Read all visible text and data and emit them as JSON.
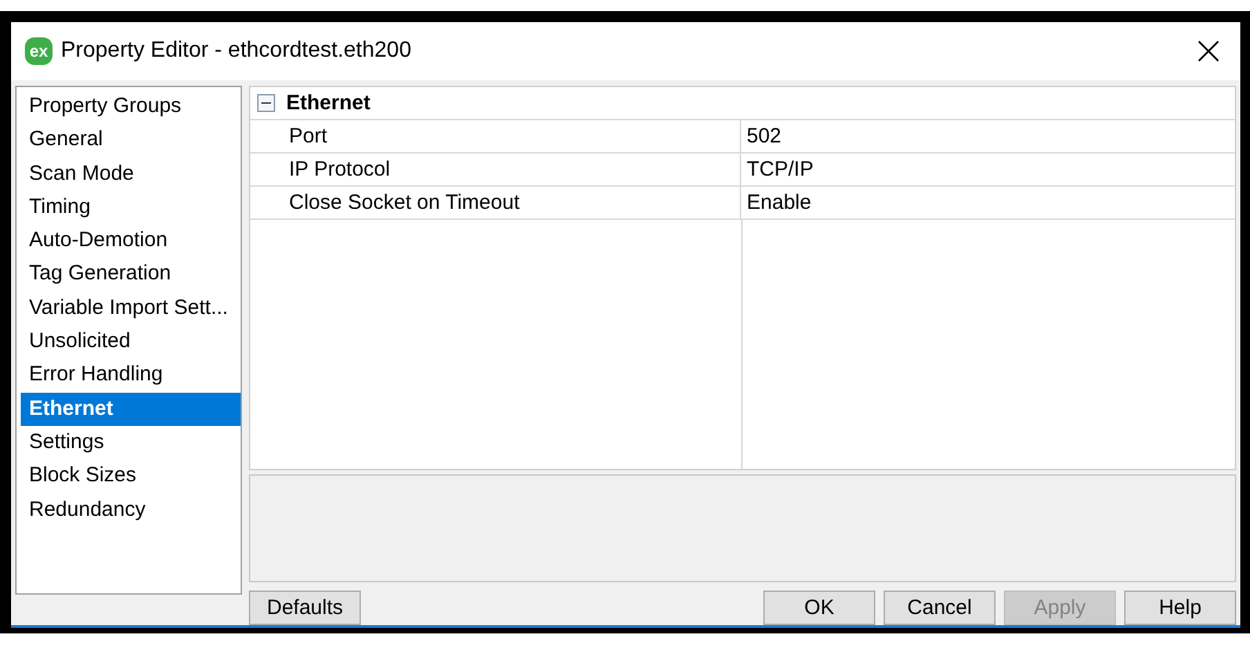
{
  "window": {
    "title": "Property Editor - ethcordtest.eth200",
    "icon_text": "ex"
  },
  "sidebar": {
    "items": [
      {
        "label": "Property Groups",
        "selected": false
      },
      {
        "label": "General",
        "selected": false
      },
      {
        "label": "Scan Mode",
        "selected": false
      },
      {
        "label": "Timing",
        "selected": false
      },
      {
        "label": "Auto-Demotion",
        "selected": false
      },
      {
        "label": "Tag Generation",
        "selected": false
      },
      {
        "label": "Variable Import Sett...",
        "selected": false
      },
      {
        "label": "Unsolicited",
        "selected": false
      },
      {
        "label": "Error Handling",
        "selected": false
      },
      {
        "label": "Ethernet",
        "selected": true
      },
      {
        "label": "Settings",
        "selected": false
      },
      {
        "label": "Block Sizes",
        "selected": false
      },
      {
        "label": "Redundancy",
        "selected": false
      }
    ]
  },
  "property_grid": {
    "group": {
      "name": "Ethernet",
      "expanded": true
    },
    "rows": [
      {
        "name": "Port",
        "value": "502"
      },
      {
        "name": "IP Protocol",
        "value": "TCP/IP"
      },
      {
        "name": "Close Socket on Timeout",
        "value": "Enable"
      }
    ]
  },
  "buttons": [
    {
      "label": "Defaults",
      "disabled": false
    },
    {
      "label": "OK",
      "disabled": false
    },
    {
      "label": "Cancel",
      "disabled": false
    },
    {
      "label": "Apply",
      "disabled": true
    },
    {
      "label": "Help",
      "disabled": false
    }
  ]
}
